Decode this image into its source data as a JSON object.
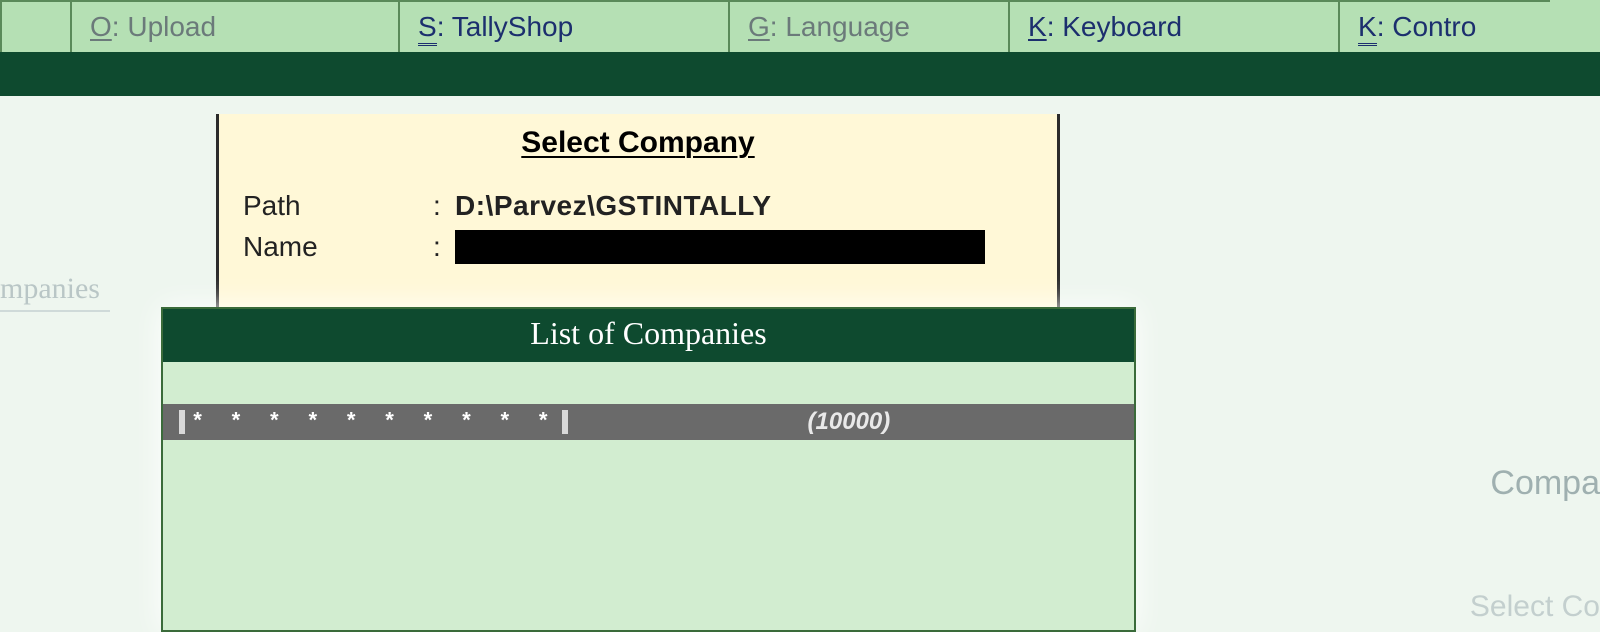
{
  "menu": [
    {
      "hotkey": "O",
      "label": "Upload",
      "style": "single",
      "enabled": false
    },
    {
      "hotkey": "S",
      "label": "TallyShop",
      "style": "double",
      "enabled": true
    },
    {
      "hotkey": "G",
      "label": "Language",
      "style": "single",
      "enabled": false
    },
    {
      "hotkey": "K",
      "label": "Keyboard",
      "style": "single",
      "enabled": true
    },
    {
      "hotkey": "K",
      "label": "Contro",
      "style": "double",
      "enabled": true
    }
  ],
  "background_labels": {
    "left": "mpanies",
    "right1": "Compa",
    "right2": "Select Co"
  },
  "select_company": {
    "title": "Select Company",
    "path_label": "Path",
    "path_value": "D:\\Parvez\\GSTINTALLY",
    "name_label": "Name",
    "name_value": ""
  },
  "company_list": {
    "header": "List of Companies",
    "items": [
      {
        "masked": "* * * * * * * * * *",
        "code": "(10000)"
      }
    ]
  }
}
